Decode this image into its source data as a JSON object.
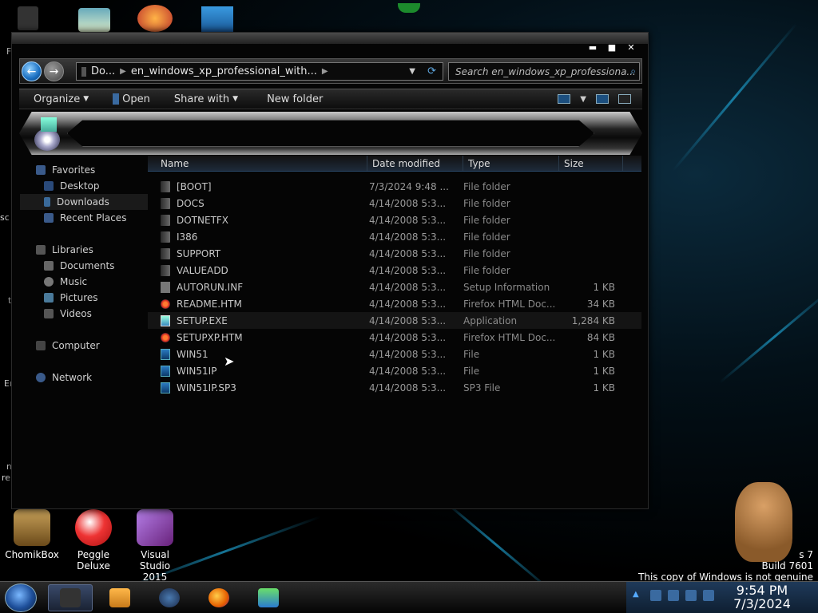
{
  "window": {
    "controls": [
      "▬",
      "■",
      "✕"
    ]
  },
  "address": {
    "segments": [
      "Do...",
      "en_windows_xp_professional_with..."
    ],
    "search_placeholder": "Search en_windows_xp_professiona..."
  },
  "toolbar": {
    "organize": "Organize",
    "open": "Open",
    "share_with": "Share with",
    "new_folder": "New folder"
  },
  "nav": {
    "favorites": "Favorites",
    "desktop": "Desktop",
    "downloads": "Downloads",
    "recent_places": "Recent Places",
    "libraries": "Libraries",
    "documents": "Documents",
    "music": "Music",
    "pictures": "Pictures",
    "videos": "Videos",
    "computer": "Computer",
    "network": "Network"
  },
  "columns": {
    "name": "Name",
    "date": "Date modified",
    "type": "Type",
    "size": "Size"
  },
  "files": [
    {
      "name": "[BOOT]",
      "date": "7/3/2024 9:48 ...",
      "type": "File folder",
      "size": "",
      "icon": "folder"
    },
    {
      "name": "DOCS",
      "date": "4/14/2008 5:3...",
      "type": "File folder",
      "size": "",
      "icon": "folder"
    },
    {
      "name": "DOTNETFX",
      "date": "4/14/2008 5:3...",
      "type": "File folder",
      "size": "",
      "icon": "folder"
    },
    {
      "name": "I386",
      "date": "4/14/2008 5:3...",
      "type": "File folder",
      "size": "",
      "icon": "folder"
    },
    {
      "name": "SUPPORT",
      "date": "4/14/2008 5:3...",
      "type": "File folder",
      "size": "",
      "icon": "folder"
    },
    {
      "name": "VALUEADD",
      "date": "4/14/2008 5:3...",
      "type": "File folder",
      "size": "",
      "icon": "folder"
    },
    {
      "name": "AUTORUN.INF",
      "date": "4/14/2008 5:3...",
      "type": "Setup Information",
      "size": "1 KB",
      "icon": "inf"
    },
    {
      "name": "README.HTM",
      "date": "4/14/2008 5:3...",
      "type": "Firefox HTML Doc...",
      "size": "34 KB",
      "icon": "htm"
    },
    {
      "name": "SETUP.EXE",
      "date": "4/14/2008 5:3...",
      "type": "Application",
      "size": "1,284 KB",
      "icon": "exe"
    },
    {
      "name": "SETUPXP.HTM",
      "date": "4/14/2008 5:3...",
      "type": "Firefox HTML Doc...",
      "size": "84 KB",
      "icon": "htm"
    },
    {
      "name": "WIN51",
      "date": "4/14/2008 5:3...",
      "type": "File",
      "size": "1 KB",
      "icon": "file"
    },
    {
      "name": "WIN51IP",
      "date": "4/14/2008 5:3...",
      "type": "File",
      "size": "1 KB",
      "icon": "file"
    },
    {
      "name": "WIN51IP.SP3",
      "date": "4/14/2008 5:3...",
      "type": "SP3 File",
      "size": "1 KB",
      "icon": "file"
    }
  ],
  "desktop_icons": [
    {
      "label": "ChomikBox"
    },
    {
      "label": "Peggle Deluxe"
    },
    {
      "label": "Visual Studio 2015"
    }
  ],
  "watermark": {
    "line1": "s 7",
    "line2": "Build 7601",
    "line3": "This copy of Windows is not genuine"
  },
  "clock": {
    "time": "9:54 PM",
    "date": "7/3/2024"
  },
  "edge_text": [
    "F",
    "sc",
    "t",
    "Er",
    "n",
    "re"
  ]
}
